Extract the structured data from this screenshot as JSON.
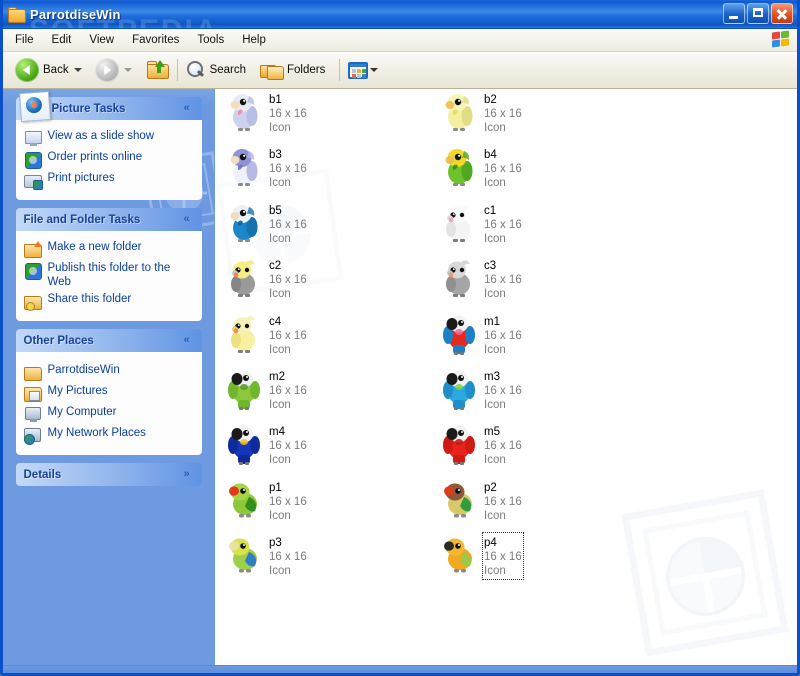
{
  "window": {
    "title": "ParrotdiseWin",
    "title_icon": "folder-icon",
    "watermark_text": "SOFTPEDIA",
    "buttons": {
      "minimize": "minimize-button",
      "maximize": "maximize-button",
      "close": "close-button"
    }
  },
  "menubar": {
    "items": [
      {
        "label": "File"
      },
      {
        "label": "Edit"
      },
      {
        "label": "View"
      },
      {
        "label": "Favorites"
      },
      {
        "label": "Tools"
      },
      {
        "label": "Help"
      }
    ]
  },
  "toolbar": {
    "back_label": "Back",
    "search_label": "Search",
    "folders_label": "Folders"
  },
  "sidebar": {
    "panels": [
      {
        "title": "Picture Tasks",
        "collapsed": false,
        "chevron": "«",
        "items": [
          {
            "label": "View as a slide show",
            "icon": "slideshow-icon"
          },
          {
            "label": "Order prints online",
            "icon": "globe-icon"
          },
          {
            "label": "Print pictures",
            "icon": "printer-icon"
          }
        ]
      },
      {
        "title": "File and Folder Tasks",
        "collapsed": false,
        "chevron": "«",
        "items": [
          {
            "label": "Make a new folder",
            "icon": "new-folder-icon"
          },
          {
            "label": "Publish this folder to the Web",
            "icon": "publish-web-icon"
          },
          {
            "label": "Share this folder",
            "icon": "share-folder-icon"
          }
        ]
      },
      {
        "title": "Other Places",
        "collapsed": false,
        "chevron": "«",
        "items": [
          {
            "label": "ParrotdiseWin",
            "icon": "folder-icon"
          },
          {
            "label": "My Pictures",
            "icon": "my-pictures-icon"
          },
          {
            "label": "My Computer",
            "icon": "my-computer-icon"
          },
          {
            "label": "My Network Places",
            "icon": "network-places-icon"
          }
        ]
      },
      {
        "title": "Details",
        "collapsed": true,
        "chevron": "»",
        "items": []
      }
    ]
  },
  "files": {
    "size_label": "16 x 16",
    "type_label": "Icon",
    "items": [
      {
        "name": "b1",
        "size": "16 x 16",
        "type": "Icon",
        "icon": "budgie-lilac-icon",
        "focused": false,
        "colors": {
          "body": "#cdd2f0",
          "head": "#e8eaf8",
          "beak": "#f3dcc0",
          "accent": "#f08aa8",
          "wing": "#b9bfe4"
        }
      },
      {
        "name": "b2",
        "size": "16 x 16",
        "type": "Icon",
        "icon": "budgie-yellow-icon",
        "focused": false,
        "colors": {
          "body": "#f4f0a2",
          "head": "#f7f4b8",
          "beak": "#f0c45a",
          "accent": "#e8d84a",
          "wing": "#e3dc86"
        }
      },
      {
        "name": "b3",
        "size": "16 x 16",
        "type": "Icon",
        "icon": "budgie-violet-icon",
        "focused": false,
        "colors": {
          "body": "#eef0fa",
          "head": "#8f93d6",
          "beak": "#f3dcc0",
          "accent": "#6f73c4",
          "wing": "#b7bae4"
        }
      },
      {
        "name": "b4",
        "size": "16 x 16",
        "type": "Icon",
        "icon": "budgie-green-icon",
        "focused": false,
        "colors": {
          "body": "#6fc22c",
          "head": "#f2d928",
          "beak": "#e8c24a",
          "accent": "#2f8f1f",
          "wing": "#4fa81e"
        }
      },
      {
        "name": "b5",
        "size": "16 x 16",
        "type": "Icon",
        "icon": "budgie-blue-icon",
        "focused": false,
        "colors": {
          "body": "#1b86c8",
          "head": "#e9f2f8",
          "beak": "#f3dcc0",
          "accent": "#0f5f98",
          "wing": "#1572ad"
        }
      },
      {
        "name": "c1",
        "size": "16 x 16",
        "type": "Icon",
        "icon": "cockatiel-white-icon",
        "focused": false,
        "colors": {
          "body": "#f4f4f4",
          "head": "#fafafa",
          "beak": "#dcdcdc",
          "accent": "#f4a0b4",
          "wing": "#e4e4e4"
        }
      },
      {
        "name": "c2",
        "size": "16 x 16",
        "type": "Icon",
        "icon": "cockatiel-grey-yellow-icon",
        "focused": false,
        "colors": {
          "body": "#9a9a9a",
          "head": "#f4ee84",
          "beak": "#c9c9c9",
          "accent": "#f07a50",
          "wing": "#868686"
        }
      },
      {
        "name": "c3",
        "size": "16 x 16",
        "type": "Icon",
        "icon": "cockatiel-grey-icon",
        "focused": false,
        "colors": {
          "body": "#a5a5a5",
          "head": "#d8d8d8",
          "beak": "#c4c4c4",
          "accent": "#f09a6a",
          "wing": "#909090"
        }
      },
      {
        "name": "c4",
        "size": "16 x 16",
        "type": "Icon",
        "icon": "cockatiel-yellow-icon",
        "focused": false,
        "colors": {
          "body": "#f6f0a0",
          "head": "#f8f3b4",
          "beak": "#e8d070",
          "accent": "#f4845a",
          "wing": "#ece27e"
        }
      },
      {
        "name": "m1",
        "size": "16 x 16",
        "type": "Icon",
        "icon": "macaw-scarlet-icon",
        "focused": false,
        "colors": {
          "body": "#e22a22",
          "head": "#f2f2f2",
          "beak": "#1a1a1a",
          "accent": "#f06a8a",
          "wing": "#1f7fc4"
        }
      },
      {
        "name": "m2",
        "size": "16 x 16",
        "type": "Icon",
        "icon": "macaw-green-icon",
        "focused": false,
        "colors": {
          "body": "#8cc83a",
          "head": "#f2f2f2",
          "beak": "#1a1a1a",
          "accent": "#4f9e22",
          "wing": "#6fb82e"
        }
      },
      {
        "name": "m3",
        "size": "16 x 16",
        "type": "Icon",
        "icon": "macaw-blue-icon",
        "focused": false,
        "colors": {
          "body": "#2aa8e0",
          "head": "#f2f2f2",
          "beak": "#1a1a1a",
          "accent": "#7fd44a",
          "wing": "#1f8fcc"
        }
      },
      {
        "name": "m4",
        "size": "16 x 16",
        "type": "Icon",
        "icon": "macaw-hyacinth-icon",
        "focused": false,
        "colors": {
          "body": "#1536b8",
          "head": "#f2f2f2",
          "beak": "#1a1a1a",
          "accent": "#f2c21a",
          "wing": "#0f2a9a"
        }
      },
      {
        "name": "m5",
        "size": "16 x 16",
        "type": "Icon",
        "icon": "macaw-red-icon",
        "focused": false,
        "colors": {
          "body": "#e8231c",
          "head": "#f2f2f2",
          "beak": "#1a1a1a",
          "accent": "#c01410",
          "wing": "#d01a14"
        }
      },
      {
        "name": "p1",
        "size": "16 x 16",
        "type": "Icon",
        "icon": "parrotlet-green-red-icon",
        "focused": false,
        "colors": {
          "body": "#8cc83a",
          "head": "#a8d44a",
          "beak": "#e03a1a",
          "accent": "#2f8f1f",
          "wing": "#6fb82e"
        }
      },
      {
        "name": "p2",
        "size": "16 x 16",
        "type": "Icon",
        "icon": "lovebird-peach-icon",
        "focused": false,
        "colors": {
          "body": "#d8c86a",
          "head": "#8a5a3a",
          "beak": "#e03a1a",
          "accent": "#2f9e3a",
          "wing": "#3aa84a"
        }
      },
      {
        "name": "p3",
        "size": "16 x 16",
        "type": "Icon",
        "icon": "parrotlet-blue-green-icon",
        "focused": false,
        "colors": {
          "body": "#9ed04a",
          "head": "#d8e24a",
          "beak": "#e8e2a0",
          "accent": "#2f7fc4",
          "wing": "#6fb82e"
        }
      },
      {
        "name": "p4",
        "size": "16 x 16",
        "type": "Icon",
        "icon": "sun-conure-icon",
        "focused": true,
        "colors": {
          "body": "#f2a820",
          "head": "#f4b830",
          "beak": "#2a2a2a",
          "accent": "#9ec84a",
          "wing": "#a8cc4a"
        }
      }
    ]
  }
}
